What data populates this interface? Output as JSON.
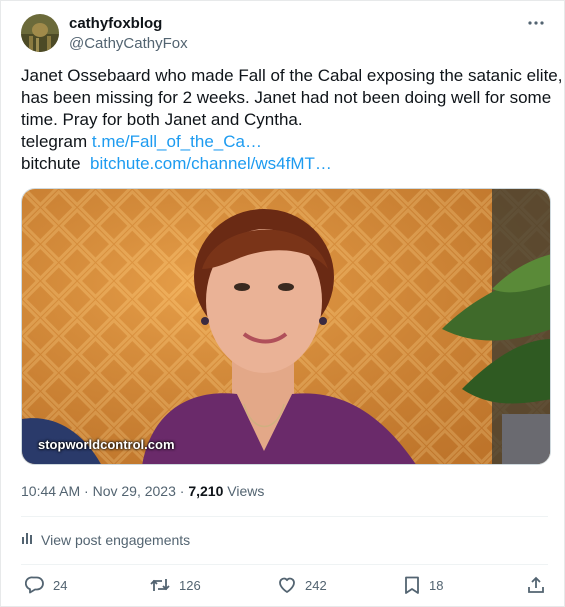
{
  "user": {
    "display_name": "cathyfoxblog",
    "handle": "@CathyCathyFox"
  },
  "tweet": {
    "lines": [
      "Janet Ossebaard who made Fall of the Cabal exposing the satanic elite,",
      "has been missing for 2 weeks. Janet had not been doing well for some",
      "time. Pray for both Janet and Cyntha."
    ],
    "telegram_label": "telegram",
    "telegram_link": "t.me/Fall_of_the_Ca…",
    "bitchute_label": "bitchute",
    "bitchute_link": "bitchute.com/channel/ws4fMT…"
  },
  "media": {
    "watermark": "stopworldcontrol.com"
  },
  "meta": {
    "timestamp": "10:44 AM · Nov 29, 2023 ·",
    "views_count": "7,210",
    "views_label": "Views"
  },
  "engagements_label": "View post engagements",
  "actions": {
    "replies": "24",
    "reposts": "126",
    "likes": "242",
    "bookmarks": "18"
  },
  "colors": {
    "link": "#1d9bf0",
    "secondary_text": "#536471",
    "primary_text": "#0f1419"
  },
  "icons": [
    "more-icon",
    "analytics-icon",
    "reply-icon",
    "repost-icon",
    "like-icon",
    "bookmark-icon",
    "share-icon"
  ]
}
